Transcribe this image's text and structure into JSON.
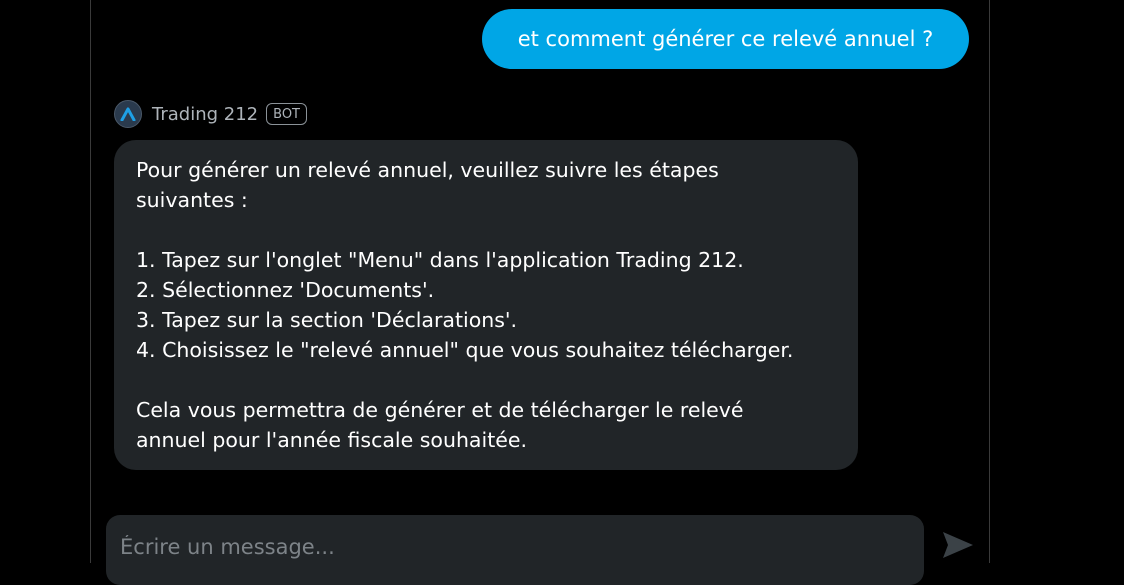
{
  "messages": {
    "user": {
      "text": "et comment générer ce relevé annuel ?"
    },
    "bot": {
      "name": "Trading 212",
      "badge": "BOT",
      "avatar_icon": "trading212-logo-icon",
      "lines": [
        "Pour générer un relevé annuel, veuillez suivre les étapes",
        "suivantes :",
        "",
        "1. Tapez sur l'onglet \"Menu\" dans l'application Trading 212.",
        "2. Sélectionnez 'Documents'.",
        "3. Tapez sur la section 'Déclarations'.",
        "4. Choisissez le \"relevé annuel\" que vous souhaitez télécharger.",
        "",
        "Cela vous permettra de générer et de télécharger le relevé",
        "annuel pour l'année fiscale souhaitée."
      ]
    }
  },
  "composer": {
    "placeholder": "Écrire un message...",
    "value": "",
    "send_icon": "send-icon"
  },
  "colors": {
    "background": "#000000",
    "user_bubble": "#00a6e6",
    "bot_bubble": "#212528",
    "muted_text": "#aeb4ba"
  }
}
